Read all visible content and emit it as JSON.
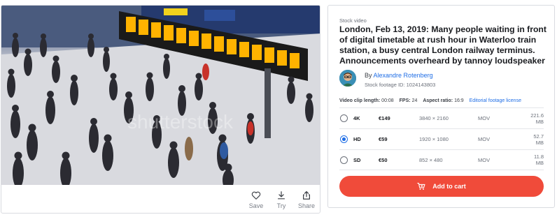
{
  "preview": {
    "watermark": "shutterstock",
    "actions": [
      {
        "icon": "heart-icon",
        "label": "Save"
      },
      {
        "icon": "download-icon",
        "label": "Try"
      },
      {
        "icon": "share-icon",
        "label": "Share"
      }
    ]
  },
  "info": {
    "kicker": "Stock video",
    "title": "London, Feb 13, 2019: Many people waiting in front of digital timetable at rush hour in Waterloo train station, a busy central London railway terminus. Announcements overheard by tannoy loudspeaker",
    "by_prefix": "By",
    "author": "Alexandre Rotenberg",
    "footage_id": "Stock footage ID: 1024143803",
    "meta": {
      "length_label": "Video clip length:",
      "length_value": "00:08",
      "fps_label": "FPS:",
      "fps_value": "24",
      "aspect_label": "Aspect ratio:",
      "aspect_value": "16:9",
      "license_link": "Editorial footage license"
    },
    "options": [
      {
        "size": "4K",
        "price": "€149",
        "dims": "3840 × 2160",
        "format": "MOV",
        "file_size": "221.6 MB",
        "selected": false
      },
      {
        "size": "HD",
        "price": "€59",
        "dims": "1920 × 1080",
        "format": "MOV",
        "file_size": "52.7 MB",
        "selected": true
      },
      {
        "size": "SD",
        "price": "€50",
        "dims": "852 × 480",
        "format": "MOV",
        "file_size": "11.8 MB",
        "selected": false
      }
    ],
    "cart_label": "Add to cart"
  },
  "colors": {
    "accent": "#1f6ee6",
    "cart": "#f04b3a",
    "departure_board": "#ffb300"
  }
}
